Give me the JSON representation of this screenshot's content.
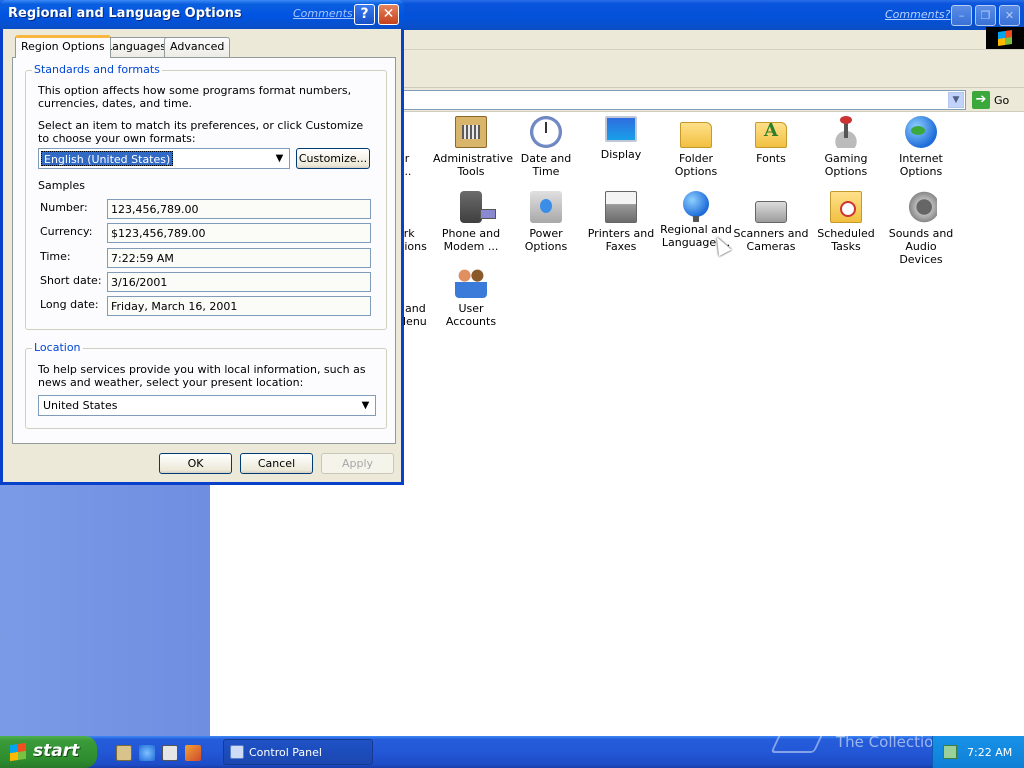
{
  "control_panel": {
    "title_comments": "Comments?",
    "address": {
      "go_label": "Go"
    },
    "items": [
      {
        "label": "Administrative Tools",
        "icon": "administrative-tools-icon"
      },
      {
        "label": "Date and Time",
        "icon": "date-time-icon"
      },
      {
        "label": "Display",
        "icon": "display-icon"
      },
      {
        "label": "Folder Options",
        "icon": "folder-options-icon"
      },
      {
        "label": "Fonts",
        "icon": "fonts-icon"
      },
      {
        "label": "Gaming Options",
        "icon": "gaming-options-icon"
      },
      {
        "label": "Internet Options",
        "icon": "internet-options-icon"
      },
      {
        "label": "Phone and Modem ...",
        "icon": "phone-modem-icon"
      },
      {
        "label": "Power Options",
        "icon": "power-options-icon"
      },
      {
        "label": "Printers and Faxes",
        "icon": "printers-faxes-icon"
      },
      {
        "label": "Regional and Language ...",
        "icon": "regional-language-icon"
      },
      {
        "label": "Scanners and Cameras",
        "icon": "scanners-cameras-icon"
      },
      {
        "label": "Scheduled Tasks",
        "icon": "scheduled-tasks-icon"
      },
      {
        "label": "Sounds and Audio Devices",
        "icon": "sounds-audio-icon"
      },
      {
        "label": "User Accounts",
        "icon": "user-accounts-icon"
      }
    ],
    "partial_items": [
      "or",
      "y...",
      "ork",
      "ctions",
      "r and",
      "lenu"
    ]
  },
  "dialog": {
    "title": "Regional and Language Options",
    "comments": "Comments?",
    "help_glyph": "?",
    "close_glyph": "✕",
    "tabs": [
      {
        "label": "Region Options",
        "active": true
      },
      {
        "label": "Languages",
        "active": false
      },
      {
        "label": "Advanced",
        "active": false
      }
    ],
    "standards": {
      "title": "Standards and formats",
      "desc1": "This option affects how some programs format numbers, currencies, dates, and time.",
      "desc2": "Select an item to match its preferences, or click Customize to choose your own formats:",
      "format_value": "English (United States)",
      "customize_label": "Customize...",
      "samples_title": "Samples",
      "samples": [
        {
          "label": "Number:",
          "value": "123,456,789.00"
        },
        {
          "label": "Currency:",
          "value": "$123,456,789.00"
        },
        {
          "label": "Time:",
          "value": "7:22:59 AM"
        },
        {
          "label": "Short date:",
          "value": "3/16/2001"
        },
        {
          "label": "Long date:",
          "value": "Friday, March 16, 2001"
        }
      ]
    },
    "location": {
      "title": "Location",
      "desc": "To help services provide you with local information, such as news and weather, select your present location:",
      "value": "United States"
    },
    "buttons": {
      "ok": "OK",
      "cancel": "Cancel",
      "apply": "Apply"
    }
  },
  "taskbar": {
    "start_label": "start",
    "task_label": "Control Panel",
    "clock": "7:22 AM",
    "watermark": "The Collection Book"
  },
  "colors": {
    "title_blue": "#0054e3",
    "start_green": "#2f8f2f",
    "dialog_face": "#ece9d8",
    "group_title": "#0046d5",
    "left_pane": "#7b9ae6"
  }
}
